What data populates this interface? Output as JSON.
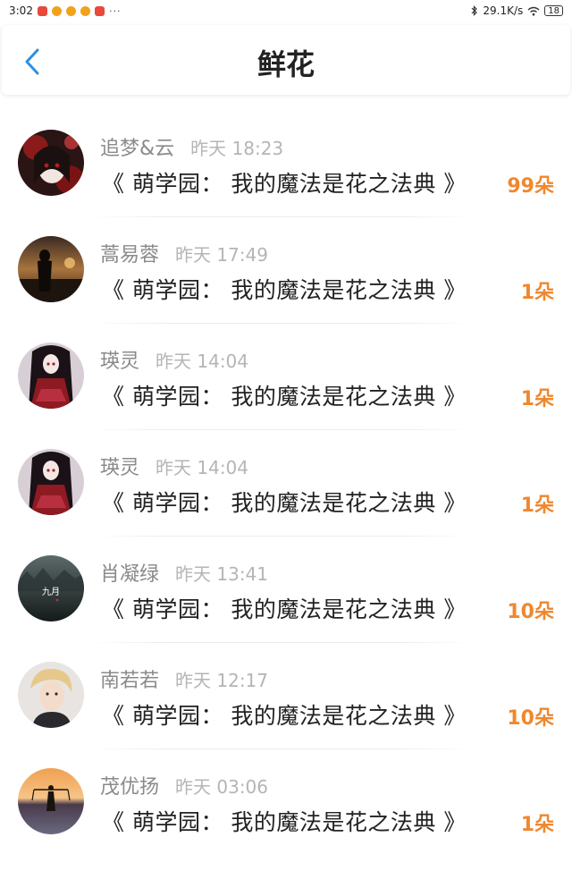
{
  "status_bar": {
    "time": "3:02",
    "more": "···",
    "net_speed": "29.1K/s",
    "battery": "18"
  },
  "header": {
    "title": "鲜花"
  },
  "colors": {
    "accent_blue": "#2f8fe0",
    "flower_orange": "#f0872d"
  },
  "records": [
    {
      "name": "追梦&云",
      "time": "昨天 18:23",
      "book": "《 萌学园： 我的魔法是花之法典 》",
      "flowers": "99朵"
    },
    {
      "name": "蒿易蓉",
      "time": "昨天 17:49",
      "book": "《 萌学园： 我的魔法是花之法典 》",
      "flowers": "1朵"
    },
    {
      "name": "瑛灵",
      "time": "昨天 14:04",
      "book": "《 萌学园： 我的魔法是花之法典 》",
      "flowers": "1朵"
    },
    {
      "name": "瑛灵",
      "time": "昨天 14:04",
      "book": "《 萌学园： 我的魔法是花之法典 》",
      "flowers": "1朵"
    },
    {
      "name": "肖凝绿",
      "time": "昨天 13:41",
      "book": "《 萌学园： 我的魔法是花之法典 》",
      "flowers": "10朵"
    },
    {
      "name": "南若若",
      "time": "昨天 12:17",
      "book": "《 萌学园： 我的魔法是花之法典 》",
      "flowers": "10朵"
    },
    {
      "name": "茂优扬",
      "time": "昨天 03:06",
      "book": "《 萌学园： 我的魔法是花之法典 》",
      "flowers": "1朵"
    }
  ],
  "avatar_text": {
    "row5": "九月"
  }
}
